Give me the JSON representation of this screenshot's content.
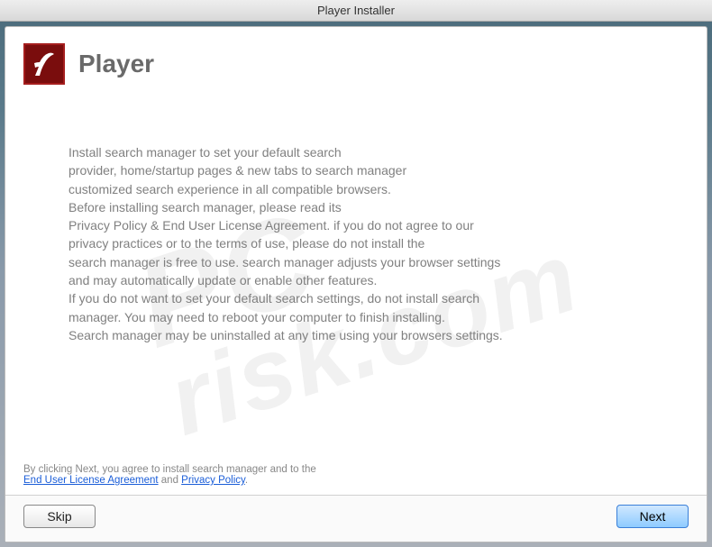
{
  "titlebar": {
    "text": "Player Installer"
  },
  "header": {
    "title": "Player",
    "icon_name": "flash-player-icon"
  },
  "body": {
    "lines": [
      "Install search manager to set your default search",
      "provider, home/startup pages & new tabs to search manager",
      "customized search experience in all compatible browsers.",
      "Before installing search manager, please read its",
      "Privacy Policy & End User License Agreement. if you do not agree to our",
      "privacy practices or to the terms of use, please do not install the",
      "search manager is free to use. search manager adjusts your browser settings",
      "and may automatically update or enable other features.",
      "If you do not want to set your default search settings, do not install search",
      "manager. You may need to reboot your computer to finish installing.",
      "Search manager may be uninstalled at any time using your browsers settings."
    ]
  },
  "footer": {
    "notice_prefix": "By clicking Next, you agree to install search manager and to the",
    "eula_link": "End User License Agreement",
    "and": " and ",
    "privacy_link": "Privacy Policy",
    "period": "."
  },
  "buttons": {
    "skip": "Skip",
    "next": "Next"
  },
  "watermark": {
    "pc": "PC",
    "risk": "risk.com"
  }
}
